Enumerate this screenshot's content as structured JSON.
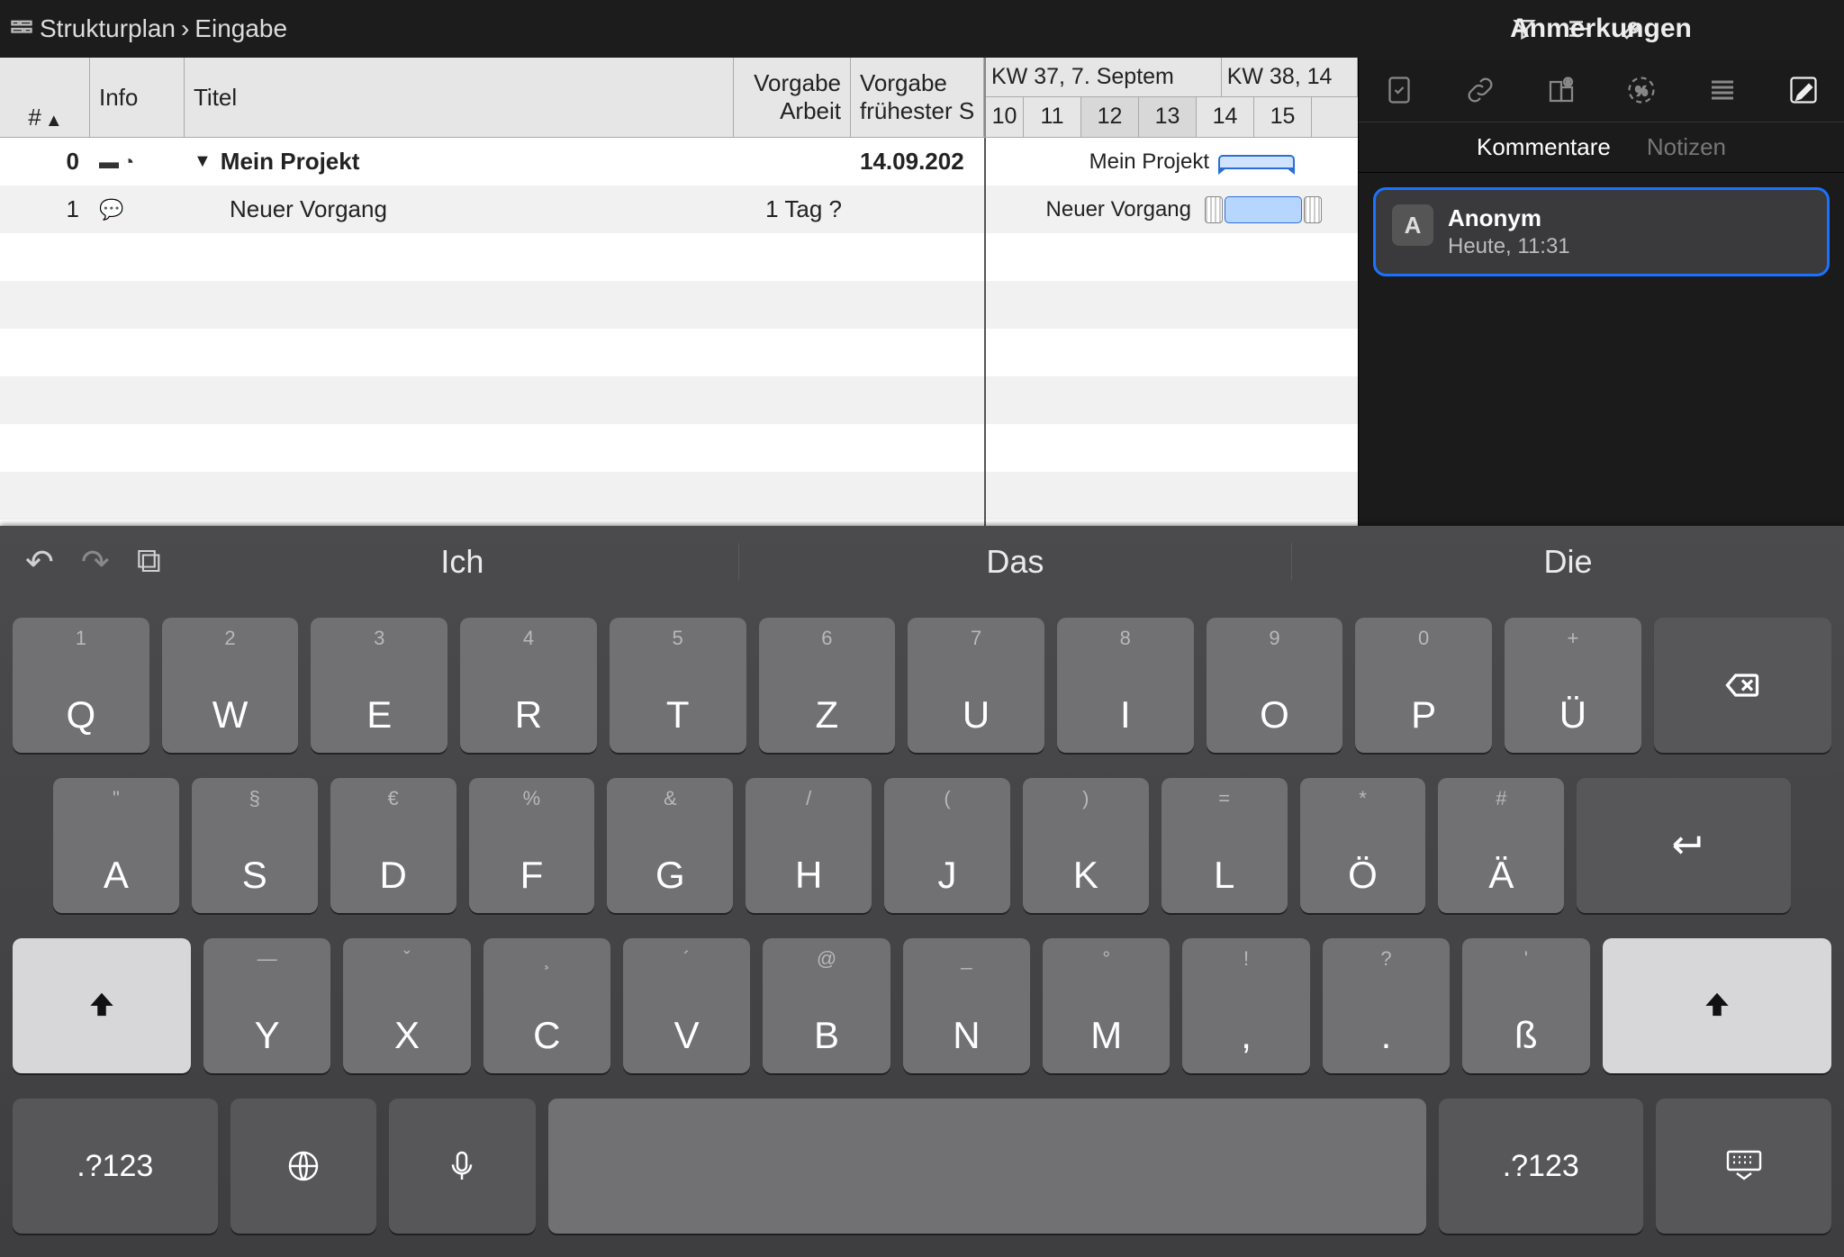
{
  "breadcrumb": {
    "root": "Strukturplan",
    "current": "Eingabe"
  },
  "panel_title": "Anmerkungen",
  "columns": {
    "num": "#",
    "info": "Info",
    "title": "Titel",
    "vorgabe1_a": "Vorgabe",
    "vorgabe1_b": "Arbeit",
    "vorgabe2_a": "Vorgabe",
    "vorgabe2_b": "frühester S"
  },
  "timeline": {
    "weeks": [
      {
        "label": "KW 37, 7. Septem",
        "days": [
          "10",
          "11",
          "12",
          "13",
          "14",
          "15"
        ],
        "weekend_idx": [
          2,
          3
        ]
      },
      {
        "label": "KW 38, 14",
        "days": []
      }
    ]
  },
  "rows": [
    {
      "num": "0",
      "title": "Mein Projekt",
      "v1": "",
      "v2": "14.09.202",
      "gantt_label": "Mein Projekt",
      "group": true
    },
    {
      "num": "1",
      "title": "Neuer Vorgang",
      "v1": "1 Tag ?",
      "v2": "",
      "gantt_label": "Neuer Vorgang",
      "group": false
    }
  ],
  "side_tabs": {
    "kommentare": "Kommentare",
    "notizen": "Notizen"
  },
  "comment": {
    "avatar": "A",
    "author": "Anonym",
    "time": "Heute, 11:31"
  },
  "keyboard": {
    "suggestions": [
      "Ich",
      "Das",
      "Die"
    ],
    "row1": [
      {
        "m": "Q",
        "h": "1"
      },
      {
        "m": "W",
        "h": "2"
      },
      {
        "m": "E",
        "h": "3"
      },
      {
        "m": "R",
        "h": "4"
      },
      {
        "m": "T",
        "h": "5"
      },
      {
        "m": "Z",
        "h": "6"
      },
      {
        "m": "U",
        "h": "7"
      },
      {
        "m": "I",
        "h": "8"
      },
      {
        "m": "O",
        "h": "9"
      },
      {
        "m": "P",
        "h": "0"
      },
      {
        "m": "Ü",
        "h": "+"
      }
    ],
    "row2": [
      {
        "m": "A",
        "h": "\""
      },
      {
        "m": "S",
        "h": "§"
      },
      {
        "m": "D",
        "h": "€"
      },
      {
        "m": "F",
        "h": "%"
      },
      {
        "m": "G",
        "h": "&"
      },
      {
        "m": "H",
        "h": "/"
      },
      {
        "m": "J",
        "h": "("
      },
      {
        "m": "K",
        "h": ")"
      },
      {
        "m": "L",
        "h": "="
      },
      {
        "m": "Ö",
        "h": "*"
      },
      {
        "m": "Ä",
        "h": "#"
      }
    ],
    "row3": [
      {
        "m": "Y",
        "h": "—"
      },
      {
        "m": "X",
        "h": "ˇ"
      },
      {
        "m": "C",
        "h": "¸"
      },
      {
        "m": "V",
        "h": "´"
      },
      {
        "m": "B",
        "h": "@"
      },
      {
        "m": "N",
        "h": "_"
      },
      {
        "m": "M",
        "h": "°"
      },
      {
        "m": ",",
        "h": "!"
      },
      {
        "m": ".",
        "h": "?"
      },
      {
        "m": "ß",
        "h": "'"
      }
    ],
    "numkey": ".?123"
  }
}
